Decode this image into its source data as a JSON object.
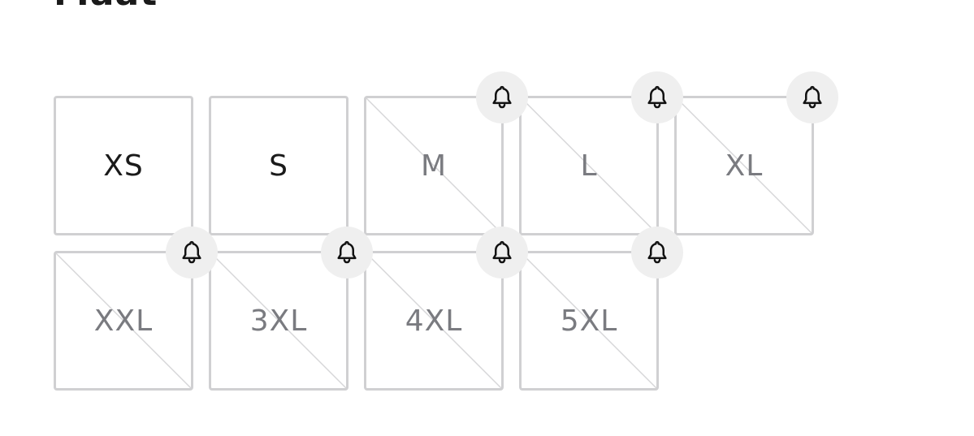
{
  "page": {
    "heading": "Maat"
  },
  "sizes": [
    {
      "label": "XS",
      "available": true
    },
    {
      "label": "S",
      "available": true
    },
    {
      "label": "M",
      "available": false
    },
    {
      "label": "L",
      "available": false
    },
    {
      "label": "XL",
      "available": false
    },
    {
      "label": "XXL",
      "available": false
    },
    {
      "label": "3XL",
      "available": false
    },
    {
      "label": "4XL",
      "available": false
    },
    {
      "label": "5XL",
      "available": false
    }
  ],
  "colors": {
    "tile_border": "#d0d0d2",
    "bell_background": "#efefef",
    "available_text": "#1a1a1a",
    "unavailable_text": "#7a7b80"
  },
  "icons": {
    "notify": "bell-icon"
  }
}
